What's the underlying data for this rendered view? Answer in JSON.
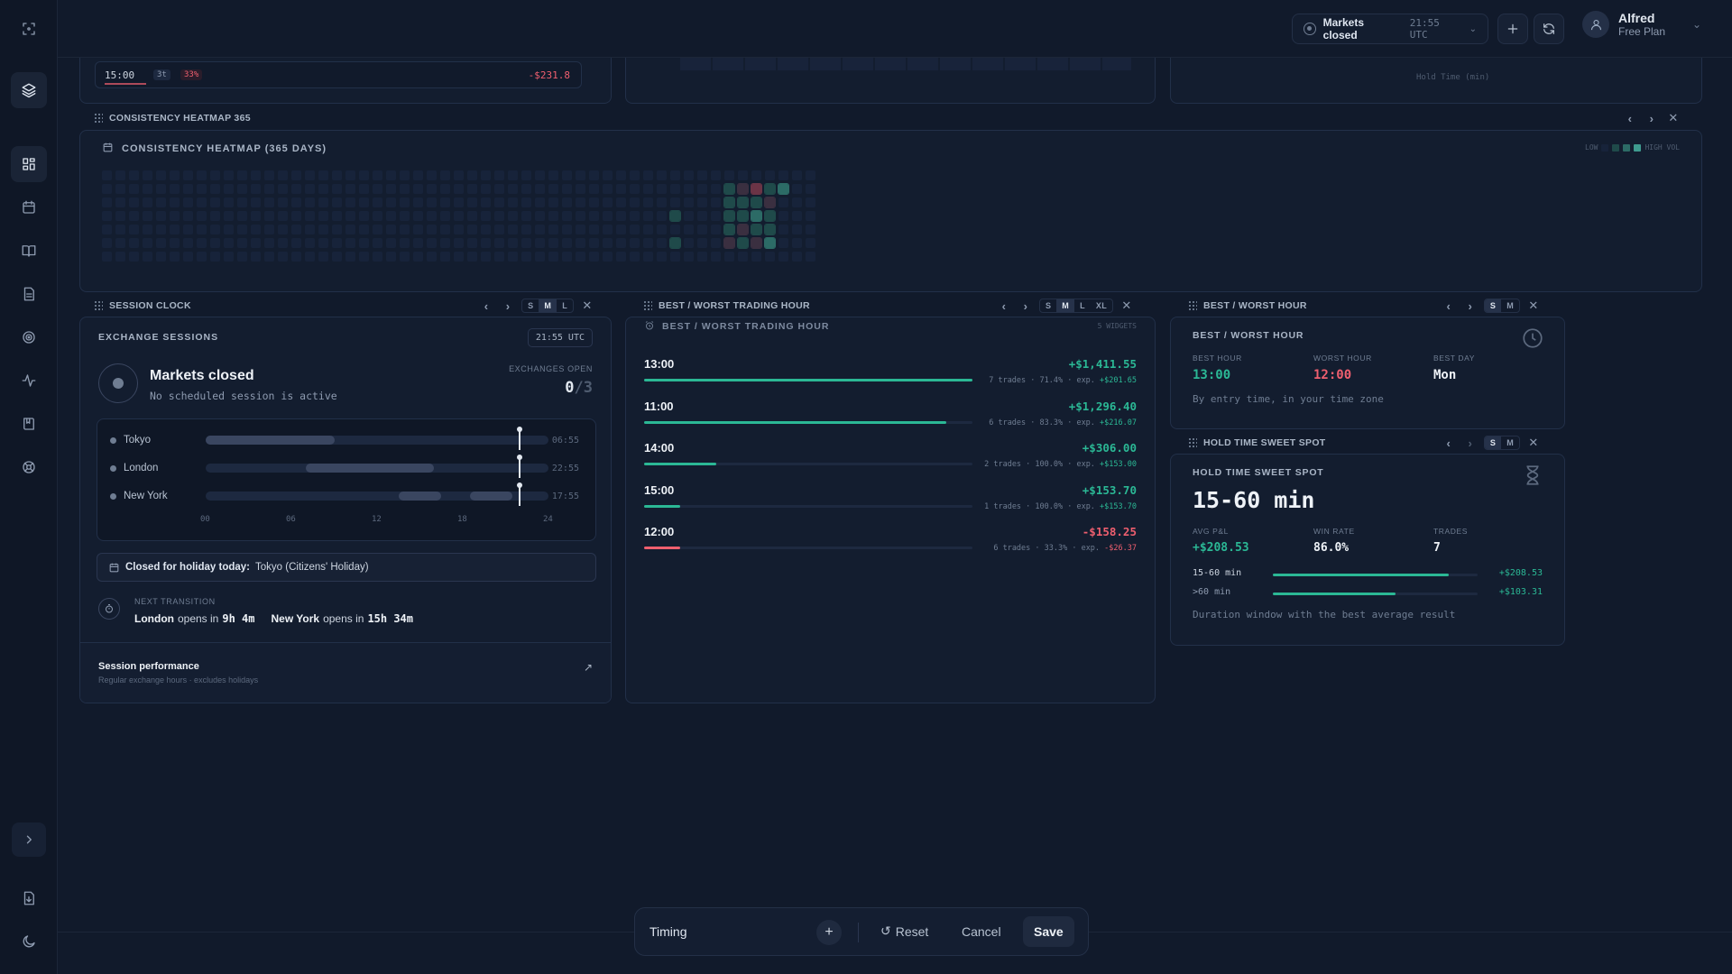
{
  "header": {
    "market_status": "Markets closed",
    "market_time": "21:55 UTC",
    "user_name": "Alfred",
    "user_plan": "Free Plan"
  },
  "top_strip": {
    "row_time": "15:00",
    "row_trades": "3t",
    "row_winrate": "33%",
    "row_pnl": "-$231.8",
    "axis_title": "Hold Time (min)"
  },
  "heatmap": {
    "bar_title": "CONSISTENCY HEATMAP 365",
    "title": "CONSISTENCY HEATMAP (365 DAYS)",
    "legend_low": "LOW",
    "legend_high": "HIGH VOL",
    "active_cells": [
      {
        "w": 42,
        "d": 3,
        "c": "#1f4a4a"
      },
      {
        "w": 42,
        "d": 5,
        "c": "#1f4a4a"
      },
      {
        "w": 46,
        "d": 1,
        "c": "#1f4a4a"
      },
      {
        "w": 46,
        "d": 2,
        "c": "#1f4a4a"
      },
      {
        "w": 46,
        "d": 3,
        "c": "#1f4a4a"
      },
      {
        "w": 46,
        "d": 4,
        "c": "#1f4a4a"
      },
      {
        "w": 46,
        "d": 5,
        "c": "#3a2f40"
      },
      {
        "w": 47,
        "d": 1,
        "c": "#3a2f40"
      },
      {
        "w": 47,
        "d": 2,
        "c": "#1f4a4a"
      },
      {
        "w": 47,
        "d": 3,
        "c": "#1f4a4a"
      },
      {
        "w": 47,
        "d": 4,
        "c": "#3a2f40"
      },
      {
        "w": 47,
        "d": 5,
        "c": "#1f4a4a"
      },
      {
        "w": 48,
        "d": 1,
        "c": "#6b3446"
      },
      {
        "w": 48,
        "d": 2,
        "c": "#1f4a4a"
      },
      {
        "w": 48,
        "d": 3,
        "c": "#2c6b66"
      },
      {
        "w": 48,
        "d": 4,
        "c": "#1f4a4a"
      },
      {
        "w": 48,
        "d": 5,
        "c": "#3a2f40"
      },
      {
        "w": 49,
        "d": 1,
        "c": "#1f4a4a"
      },
      {
        "w": 49,
        "d": 2,
        "c": "#3a2f40"
      },
      {
        "w": 49,
        "d": 3,
        "c": "#1f4a4a"
      },
      {
        "w": 49,
        "d": 4,
        "c": "#1f4a4a"
      },
      {
        "w": 49,
        "d": 5,
        "c": "#2c6b66"
      },
      {
        "w": 50,
        "d": 1,
        "c": "#2c6b66"
      }
    ]
  },
  "session_clock": {
    "bar_title": "SESSION CLOCK",
    "sizes": [
      "S",
      "M",
      "L"
    ],
    "section_title": "EXCHANGE SESSIONS",
    "time_badge": "21:55 UTC",
    "status_title": "Markets closed",
    "status_sub": "No scheduled session is active",
    "exchanges_open_label": "EXCHANGES OPEN",
    "exchanges_open_num": "0",
    "exchanges_open_den": "/3",
    "exchanges": [
      {
        "name": "Tokyo",
        "time": "06:55",
        "sessions": [
          [
            0,
            9
          ]
        ]
      },
      {
        "name": "London",
        "time": "22:55",
        "sessions": [
          [
            7,
            16
          ]
        ]
      },
      {
        "name": "New York",
        "time": "17:55",
        "sessions": [
          [
            13.5,
            16.5
          ],
          [
            18.5,
            21.5
          ]
        ]
      }
    ],
    "now_hour": 21.92,
    "ticks": [
      "00",
      "06",
      "12",
      "18",
      "24"
    ],
    "holiday_label": "Closed for holiday today:",
    "holiday_value": "Tokyo (Citizens' Holiday)",
    "next_transition_label": "NEXT TRANSITION",
    "transition_1_name": "London",
    "transition_1_text": "opens in",
    "transition_1_time": "9h 4m",
    "transition_2_name": "New York",
    "transition_2_text": "opens in",
    "transition_2_time": "15h 34m",
    "perf_title": "Session performance",
    "perf_sub": "Regular exchange hours · excludes holidays"
  },
  "best_worst_trading_hour": {
    "bar_title": "BEST / WORST TRADING HOUR",
    "sizes": [
      "S",
      "M",
      "L",
      "XL"
    ],
    "title": "BEST / WORST TRADING HOUR",
    "widgets_label": "5 WIDGETS",
    "rows": [
      {
        "hour": "13:00",
        "pnl": "+$1,411.55",
        "detail": "7 trades · 71.4% · exp.",
        "exp": "+$201.65",
        "fill": 1.0,
        "neg": false
      },
      {
        "hour": "11:00",
        "pnl": "+$1,296.40",
        "detail": "6 trades · 83.3% · exp.",
        "exp": "+$216.07",
        "fill": 0.92,
        "neg": false
      },
      {
        "hour": "14:00",
        "pnl": "+$306.00",
        "detail": "2 trades · 100.0% · exp.",
        "exp": "+$153.00",
        "fill": 0.22,
        "neg": false
      },
      {
        "hour": "15:00",
        "pnl": "+$153.70",
        "detail": "1 trades · 100.0% · exp.",
        "exp": "+$153.70",
        "fill": 0.11,
        "neg": false
      },
      {
        "hour": "12:00",
        "pnl": "-$158.25",
        "detail": "6 trades · 33.3% · exp.",
        "exp": "-$26.37",
        "fill": 0.11,
        "neg": true
      }
    ]
  },
  "best_worst_hour": {
    "bar_title": "BEST / WORST HOUR",
    "sizes": [
      "S",
      "M"
    ],
    "title": "BEST / WORST HOUR",
    "best_hour_label": "BEST HOUR",
    "best_hour": "13:00",
    "worst_hour_label": "WORST HOUR",
    "worst_hour": "12:00",
    "best_day_label": "BEST DAY",
    "best_day": "Mon",
    "note": "By entry time, in your time zone"
  },
  "hold_time": {
    "bar_title": "HOLD TIME SWEET SPOT",
    "sizes": [
      "S",
      "M"
    ],
    "title": "HOLD TIME SWEET SPOT",
    "big_value": "15-60 min",
    "avg_pnl_label": "AVG P&L",
    "avg_pnl": "+$208.53",
    "win_rate_label": "WIN RATE",
    "win_rate": "86.0%",
    "trades_label": "TRADES",
    "trades": "7",
    "rows": [
      {
        "label": "15-60 min",
        "value": "+$208.53",
        "fill": 0.86
      },
      {
        "label": ">60 min",
        "value": "+$103.31",
        "fill": 0.6
      }
    ],
    "note": "Duration window with the best average result"
  },
  "bottom_bar": {
    "layout_name": "Timing",
    "reset_label": "Reset",
    "cancel_label": "Cancel",
    "save_label": "Save"
  },
  "colors": {
    "accent_green": "#2bb895",
    "accent_red": "#ef5f6f"
  }
}
